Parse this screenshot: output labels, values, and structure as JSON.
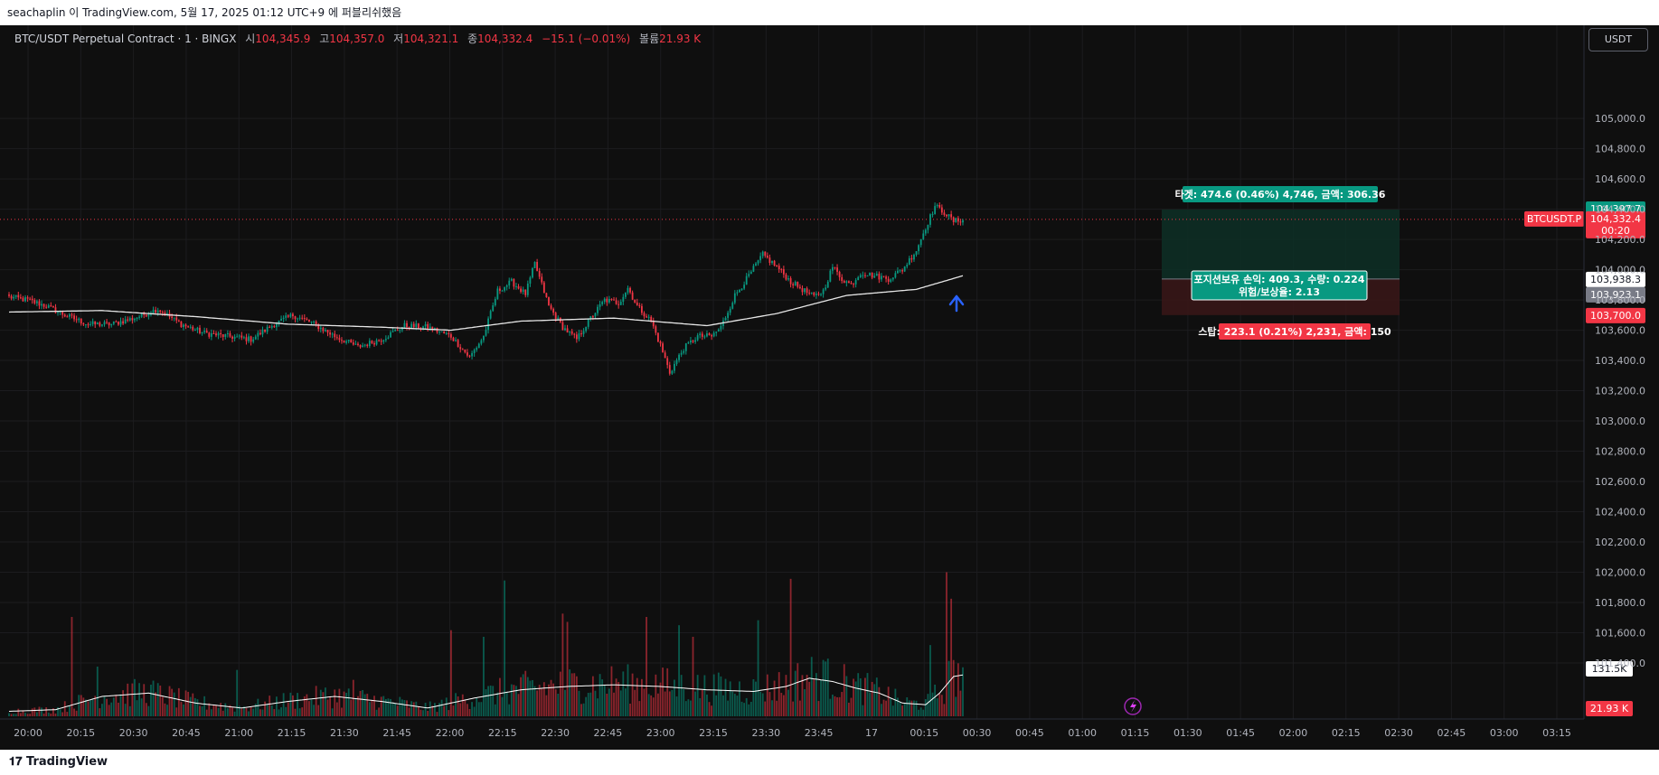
{
  "header": {
    "publish_note": "seachaplin 이 TradingView.com, 5월 17, 2025 01:12 UTC+9 에 퍼블리쉬했음"
  },
  "footer": {
    "brand": "TradingView"
  },
  "legend": {
    "symbol": "BTC/USDT Perpetual Contract · 1 · BINGX",
    "open_label": "시",
    "open": "104,345.9",
    "high_label": "고",
    "high": "104,357.0",
    "low_label": "저",
    "low": "104,321.1",
    "close_label": "종",
    "close": "104,332.4",
    "change": "−15.1 (−0.01%)",
    "volume_label": "볼륨",
    "volume": "21.93 K"
  },
  "currency_button": "USDT",
  "position": {
    "target_label": "타겟: 474.6 (0.46%) 4,746, 금액: 306.36",
    "open_pl_line1": "포지션보유 손익: 409.3, 수량: 0.224",
    "open_pl_line2": "위험/보상율: 2.13",
    "stop_label": "스탑: 223.1 (0.21%) 2,231, 금액: 150"
  },
  "price_tags": {
    "target": "104,397.7",
    "last": "104,332.4",
    "countdown": "00:20",
    "symbol": "BTCUSDT.P",
    "entry": "103,938.3",
    "ma": "103,923.1",
    "stop": "103,700.0",
    "volume_ma": "131.5K",
    "volume": "21.93 K"
  },
  "colors": {
    "up": "#089981",
    "down": "#f23645",
    "background": "#0f0f0f",
    "ma_line": "#e6e6e6",
    "target_zone": "#0d2f26",
    "stop_zone": "#3a1618",
    "arrow": "#2962ff"
  },
  "icons": {
    "alert": "lightning-icon",
    "arrow": "arrow-up-icon"
  },
  "chart_data": {
    "type": "candlestick",
    "x_ticks": [
      "20:00",
      "20:15",
      "20:30",
      "20:45",
      "21:00",
      "21:15",
      "21:30",
      "21:45",
      "22:00",
      "22:15",
      "22:30",
      "22:45",
      "23:00",
      "23:15",
      "23:30",
      "23:45",
      "17",
      "00:15",
      "00:30",
      "00:45",
      "01:00",
      "01:15",
      "01:30",
      "01:45",
      "02:00",
      "02:15",
      "02:30",
      "02:45",
      "03:00",
      "03:15"
    ],
    "y_ticks": [
      "105,000.0",
      "104,800.0",
      "104,600.0",
      "104,400.0",
      "104,200.0",
      "104,000.0",
      "103,800.0",
      "103,600.0",
      "103,400.0",
      "103,200.0",
      "103,000.0",
      "102,800.0",
      "102,600.0",
      "102,400.0",
      "102,200.0",
      "102,000.0",
      "101,800.0",
      "101,600.0",
      "101,400.0"
    ],
    "ylim": [
      101340,
      105180
    ],
    "price_levels": {
      "target": 104397.7,
      "last": 104332.4,
      "entry": 103938.3,
      "stop": 103700.0
    },
    "anchors": [
      [
        0,
        103820
      ],
      [
        8,
        103800
      ],
      [
        16,
        103760
      ],
      [
        24,
        103700
      ],
      [
        34,
        103640
      ],
      [
        44,
        103640
      ],
      [
        54,
        103680
      ],
      [
        64,
        103740
      ],
      [
        74,
        103640
      ],
      [
        84,
        103580
      ],
      [
        94,
        103560
      ],
      [
        104,
        103540
      ],
      [
        114,
        103640
      ],
      [
        122,
        103700
      ],
      [
        130,
        103650
      ],
      [
        140,
        103560
      ],
      [
        150,
        103490
      ],
      [
        160,
        103540
      ],
      [
        170,
        103630
      ],
      [
        180,
        103620
      ],
      [
        190,
        103560
      ],
      [
        198,
        103420
      ],
      [
        204,
        103560
      ],
      [
        210,
        103860
      ],
      [
        216,
        103920
      ],
      [
        222,
        103840
      ],
      [
        226,
        104040
      ],
      [
        232,
        103760
      ],
      [
        238,
        103620
      ],
      [
        244,
        103540
      ],
      [
        250,
        103680
      ],
      [
        256,
        103800
      ],
      [
        262,
        103780
      ],
      [
        266,
        103880
      ],
      [
        270,
        103760
      ],
      [
        276,
        103660
      ],
      [
        280,
        103500
      ],
      [
        284,
        103320
      ],
      [
        290,
        103480
      ],
      [
        296,
        103560
      ],
      [
        302,
        103560
      ],
      [
        306,
        103620
      ],
      [
        312,
        103830
      ],
      [
        318,
        103960
      ],
      [
        324,
        104100
      ],
      [
        330,
        104020
      ],
      [
        336,
        103920
      ],
      [
        342,
        103860
      ],
      [
        346,
        103820
      ],
      [
        350,
        103860
      ],
      [
        354,
        104020
      ],
      [
        358,
        103940
      ],
      [
        362,
        103900
      ],
      [
        366,
        103980
      ],
      [
        372,
        103960
      ],
      [
        378,
        103940
      ],
      [
        384,
        104000
      ],
      [
        390,
        104130
      ],
      [
        394,
        104280
      ],
      [
        398,
        104420
      ],
      [
        402,
        104380
      ],
      [
        406,
        104320
      ],
      [
        410,
        104332
      ]
    ],
    "ma_anchors": [
      [
        0,
        103720
      ],
      [
        40,
        103730
      ],
      [
        80,
        103690
      ],
      [
        120,
        103640
      ],
      [
        160,
        103620
      ],
      [
        190,
        103600
      ],
      [
        220,
        103660
      ],
      [
        260,
        103680
      ],
      [
        300,
        103630
      ],
      [
        330,
        103710
      ],
      [
        360,
        103830
      ],
      [
        390,
        103870
      ],
      [
        410,
        103960
      ]
    ],
    "volume_ma_anchors": [
      [
        0,
        3
      ],
      [
        20,
        4
      ],
      [
        40,
        12
      ],
      [
        60,
        14
      ],
      [
        80,
        8
      ],
      [
        100,
        5
      ],
      [
        120,
        9
      ],
      [
        140,
        12
      ],
      [
        160,
        9
      ],
      [
        180,
        5
      ],
      [
        200,
        11
      ],
      [
        220,
        16
      ],
      [
        240,
        18
      ],
      [
        260,
        19
      ],
      [
        280,
        18
      ],
      [
        300,
        16
      ],
      [
        320,
        15
      ],
      [
        334,
        18
      ],
      [
        344,
        23
      ],
      [
        354,
        21
      ],
      [
        364,
        17
      ],
      [
        374,
        14
      ],
      [
        384,
        8
      ],
      [
        394,
        7
      ],
      [
        400,
        14
      ],
      [
        406,
        24
      ],
      [
        410,
        25
      ]
    ],
    "volume_spikes": [
      [
        27,
        60
      ],
      [
        38,
        30
      ],
      [
        98,
        28
      ],
      [
        148,
        22
      ],
      [
        190,
        52
      ],
      [
        204,
        48
      ],
      [
        213,
        82
      ],
      [
        238,
        62
      ],
      [
        240,
        57
      ],
      [
        274,
        60
      ],
      [
        288,
        55
      ],
      [
        294,
        48
      ],
      [
        322,
        58
      ],
      [
        336,
        83
      ],
      [
        350,
        34
      ],
      [
        396,
        43
      ],
      [
        403,
        87
      ],
      [
        405,
        71
      ]
    ],
    "volume_ylim": [
      0,
      90
    ]
  }
}
